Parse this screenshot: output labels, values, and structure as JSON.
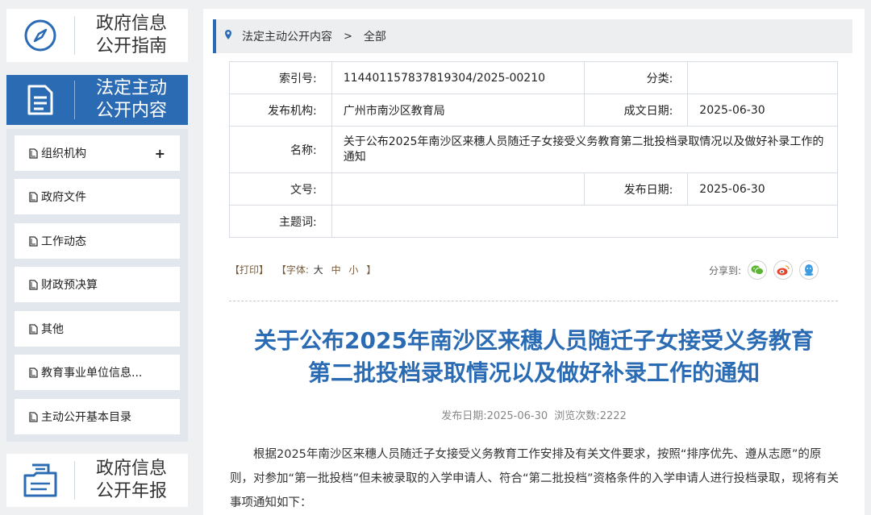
{
  "sidebar": {
    "cards": [
      {
        "label": "政府信息\n公开指南",
        "icon": "compass-icon"
      },
      {
        "label": "法定主动\n公开内容",
        "icon": "document-list-icon",
        "active": true
      },
      {
        "label": "政府信息\n公开年报",
        "icon": "report-folder-icon"
      }
    ],
    "submenu": [
      {
        "label": "组织机构",
        "has_plus": true
      },
      {
        "label": "政府文件"
      },
      {
        "label": "工作动态"
      },
      {
        "label": "财政预决算"
      },
      {
        "label": "其他"
      },
      {
        "label": "教育事业单位信息..."
      },
      {
        "label": "主动公开基本目录"
      }
    ],
    "plus_symbol": "+"
  },
  "breadcrumb": {
    "items": [
      "法定主动公开内容",
      "全部"
    ],
    "separator": ">"
  },
  "meta": {
    "index_label": "索引号:",
    "index_value": "114401157837819304/2025-00210",
    "category_label": "分类:",
    "category_value": "",
    "publisher_label": "发布机构:",
    "publisher_value": "广州市南沙区教育局",
    "created_label": "成文日期:",
    "created_value": "2025-06-30",
    "name_label": "名称:",
    "name_value": "关于公布2025年南沙区来穗人员随迁子女接受义务教育第二批投档录取情况以及做好补录工作的通知",
    "docno_label": "文号:",
    "docno_value": "",
    "pubdate_label": "发布日期:",
    "pubdate_value": "2025-06-30",
    "subject_label": "主题词:",
    "subject_value": ""
  },
  "tools": {
    "print": "【打印】",
    "font_prefix": "【字体:",
    "font_large": "大",
    "font_medium": "中",
    "font_small": "小",
    "font_suffix": "】"
  },
  "share": {
    "label": "分享到:",
    "icons": [
      "wechat-icon",
      "weibo-icon",
      "qq-icon"
    ]
  },
  "article": {
    "title_line1": "关于公布2025年南沙区来穗人员随迁子女接受义务教育",
    "title_line2": "第二批投档录取情况以及做好补录工作的通知",
    "pub_label": "发布日期:",
    "pub_date": "2025-06-30",
    "views_label": "浏览次数:",
    "views": "2222",
    "body": "根据2025年南沙区来穗人员随迁子女接受义务教育工作安排及有关文件要求，按照“排序优先、遵从志愿”的原则，对参加“第一批投档”但未被录取的入学申请人、符合“第二批投档”资格条件的入学申请人进行投档录取，现将有关事项通知如下："
  },
  "colors": {
    "accent": "#2a6bb3",
    "sidebar_bg": "#e2e7ed"
  }
}
